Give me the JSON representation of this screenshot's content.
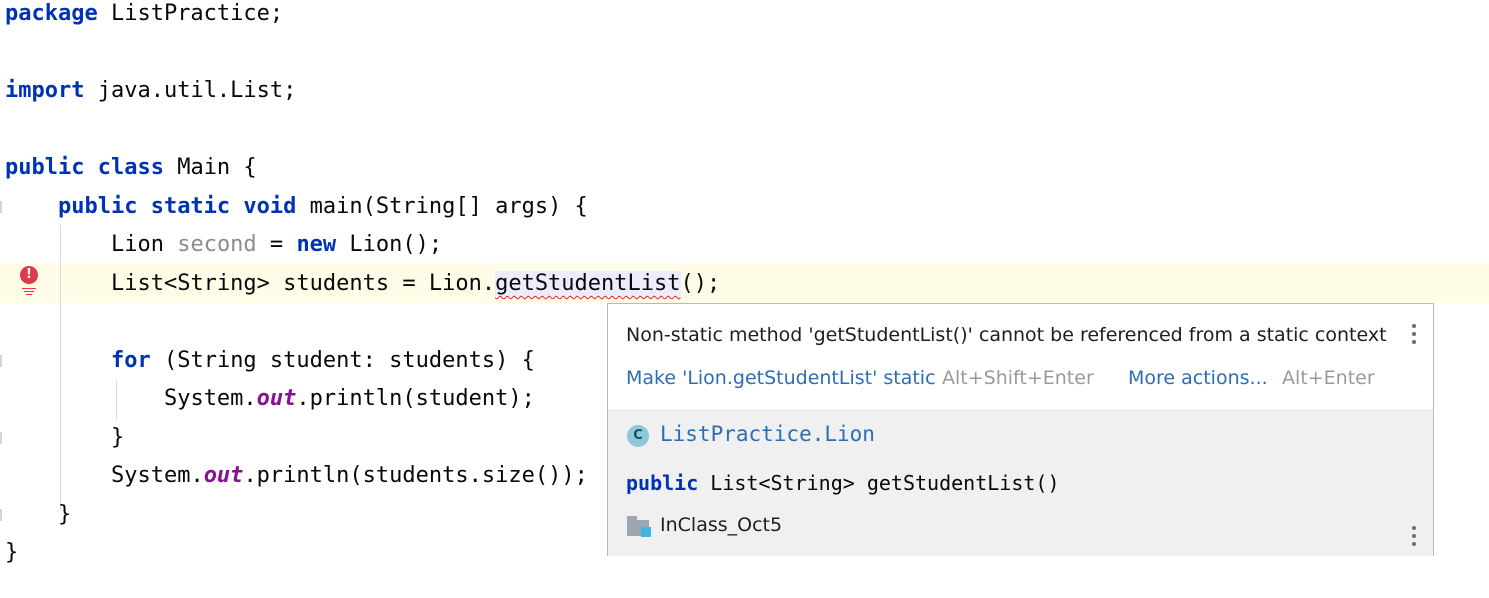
{
  "editor": {
    "lines": [
      {
        "kw": "package",
        "rest": " ListPractice;"
      },
      {
        "kw": "import",
        "rest": " java.util.List;"
      },
      {
        "kw": "public class",
        "rest": " Main {"
      },
      {
        "indent": "    ",
        "kw": "public static void",
        "rest": " main(String[] args) {"
      },
      {
        "indent": "        ",
        "pre": "Lion ",
        "unused": "second",
        "eq": " = ",
        "kw": "new",
        "rest": " Lion();"
      },
      {
        "indent": "        ",
        "pre": "List<String> students = Lion.",
        "err": "getStudentList",
        "rest": "();"
      },
      {
        "indent": "        ",
        "kw": "for",
        "rest": " (String student: students) {"
      },
      {
        "indent": "            ",
        "pre": "System.",
        "field": "out",
        "rest": ".println(student);"
      },
      {
        "indent": "        ",
        "rest": "}"
      },
      {
        "indent": "        ",
        "pre": "System.",
        "field": "out",
        "rest": ".println(students.size());"
      },
      {
        "indent": "    ",
        "rest": "}"
      },
      {
        "rest": "}"
      }
    ]
  },
  "gutter": {
    "error_icon": "error-exclamation-icon",
    "error_glyph": "!"
  },
  "popup": {
    "message": "Non-static method 'getStudentList()' cannot be referenced from a static context",
    "fix_action": "Make 'Lion.getStudentList' static",
    "fix_shortcut": "Alt+Shift+Enter",
    "more_actions": "More actions...",
    "more_shortcut": "Alt+Enter",
    "class_badge": "C",
    "class_name": "ListPractice.Lion",
    "signature_kw": "public",
    "signature_rest": " List<String> getStudentList()",
    "module": "InClass_Oct5"
  },
  "colors": {
    "keyword": "#0033b3",
    "link": "#2d6db4",
    "error": "#db3b4b",
    "current_line": "#fefbe6"
  }
}
